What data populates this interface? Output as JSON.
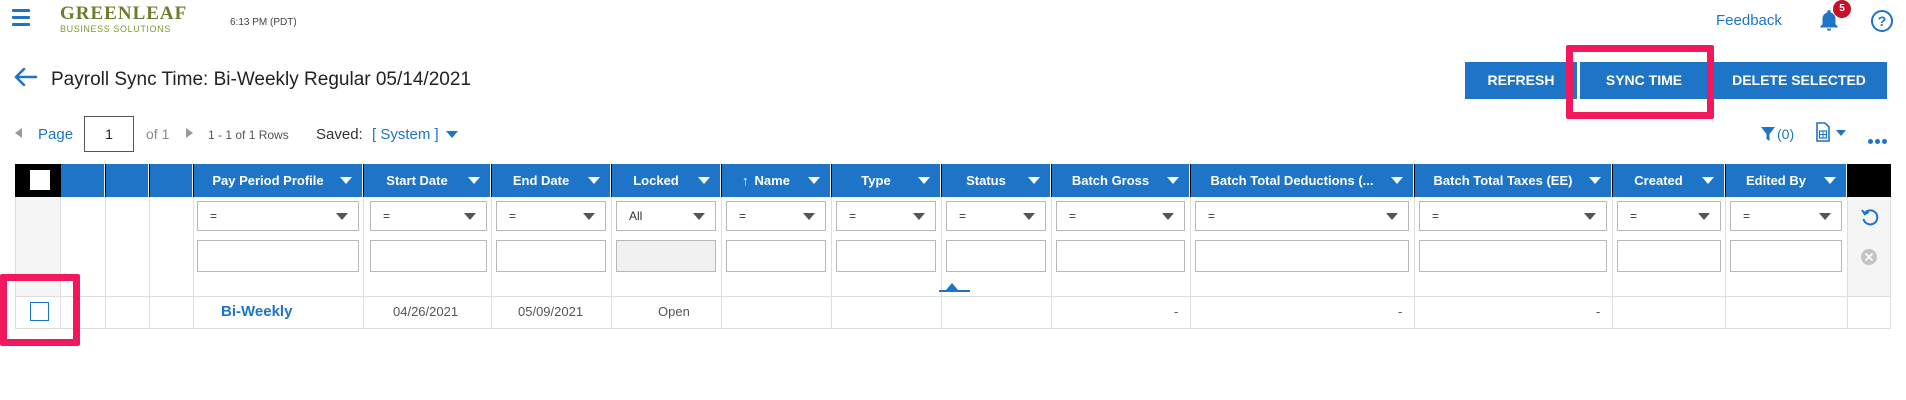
{
  "header": {
    "logo_line1": "GREENLEAF",
    "logo_line2": "BUSINESS SOLUTIONS",
    "time": "6:13 PM (PDT)",
    "feedback": "Feedback",
    "notification_count": "5",
    "help": "?"
  },
  "page": {
    "title": "Payroll Sync Time: Bi-Weekly Regular 05/14/2021"
  },
  "actions": {
    "refresh": "REFRESH",
    "sync_time": "SYNC TIME",
    "delete_selected": "DELETE SELECTED"
  },
  "pager": {
    "page_label": "Page",
    "page_value": "1",
    "of_label": "of 1",
    "rows_info": "1 - 1 of 1 Rows",
    "saved_label": "Saved:",
    "saved_view": "[ System ]",
    "filter_count": "(0)"
  },
  "grid": {
    "columns": [
      {
        "key": "pay_period_profile",
        "label": "Pay Period Profile"
      },
      {
        "key": "start_date",
        "label": "Start Date"
      },
      {
        "key": "end_date",
        "label": "End Date"
      },
      {
        "key": "locked",
        "label": "Locked"
      },
      {
        "key": "name",
        "label": "Name",
        "sort": "asc"
      },
      {
        "key": "type",
        "label": "Type"
      },
      {
        "key": "status",
        "label": "Status"
      },
      {
        "key": "batch_gross",
        "label": "Batch Gross"
      },
      {
        "key": "batch_total_deductions",
        "label": "Batch Total Deductions (..."
      },
      {
        "key": "batch_total_taxes",
        "label": "Batch Total Taxes (EE)"
      },
      {
        "key": "created",
        "label": "Created"
      },
      {
        "key": "edited_by",
        "label": "Edited By"
      }
    ],
    "filters": {
      "pay_period_profile": "=",
      "start_date": "=",
      "end_date": "=",
      "locked": "All",
      "name": "=",
      "type": "=",
      "status": "=",
      "batch_gross": "=",
      "batch_total_deductions": "=",
      "batch_total_taxes": "=",
      "created": "=",
      "edited_by": "="
    },
    "rows": [
      {
        "pay_period_profile": "Bi-Weekly",
        "start_date": "04/26/2021",
        "end_date": "05/09/2021",
        "locked": "Open",
        "name": "",
        "type": "",
        "status": "",
        "batch_gross": "-",
        "batch_total_deductions": "-",
        "batch_total_taxes": "-",
        "created": "",
        "edited_by": ""
      }
    ]
  },
  "colors": {
    "accent": "#1e74c7",
    "highlight": "#f2185d",
    "logo_green": "#6b7d2d",
    "badge": "#c8102e"
  },
  "icons": [
    "menu-icon",
    "bell-icon",
    "help-icon",
    "back-arrow-icon",
    "filter-icon",
    "export-icon",
    "more-icon",
    "reset-icon",
    "clear-icon"
  ]
}
